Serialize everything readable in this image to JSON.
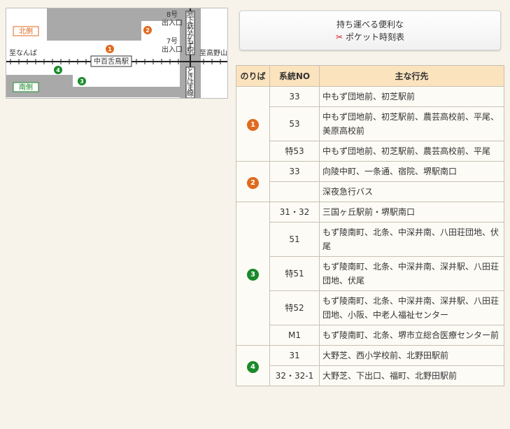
{
  "map": {
    "north_side": "北側",
    "south_side": "南側",
    "exit8": [
      "8号",
      "出入口"
    ],
    "exit7": [
      "7号",
      "出入口"
    ],
    "to_namba": "至なんば",
    "to_koyasan": "至高野山",
    "station": "中百舌鳥駅",
    "subway_station": [
      "地",
      "下",
      "鉄",
      "な",
      "か",
      "も",
      "ず",
      "駅"
    ],
    "tokihama_line": [
      "と",
      "き",
      "は",
      "ま",
      "線"
    ],
    "stop_labels": [
      "1",
      "2",
      "3",
      "4"
    ]
  },
  "pocket": {
    "line1": "持ち運べる便利な",
    "line2": "ポケット時刻表",
    "icon": "pdf-icon"
  },
  "colors": {
    "orange": "#e06a1f",
    "green": "#1a8a2a"
  },
  "table": {
    "headers": [
      "のりば",
      "系統NO",
      "主な行先"
    ],
    "groups": [
      {
        "stop": "1",
        "color": "#e06a1f",
        "rows": [
          {
            "no": "33",
            "dest": "中もず団地前、初芝駅前"
          },
          {
            "no": "53",
            "dest": "中もず団地前、初芝駅前、農芸高校前、平尾、美原高校前"
          },
          {
            "no": "特53",
            "dest": "中もず団地前、初芝駅前、農芸高校前、平尾"
          }
        ]
      },
      {
        "stop": "2",
        "color": "#e06a1f",
        "rows": [
          {
            "no": "33",
            "dest": "向陵中町、一条通、宿院、堺駅南口"
          },
          {
            "no": "",
            "dest": "深夜急行バス"
          }
        ]
      },
      {
        "stop": "3",
        "color": "#1a8a2a",
        "rows": [
          {
            "no": "31・32",
            "dest": "三国ヶ丘駅前・堺駅南口"
          },
          {
            "no": "51",
            "dest": "もず陵南町、北条、中深井南、八田荘団地、伏尾"
          },
          {
            "no": "特51",
            "dest": "もず陵南町、北条、中深井南、深井駅、八田荘団地、伏尾"
          },
          {
            "no": "特52",
            "dest": "もず陵南町、北条、中深井南、深井駅、八田荘団地、小阪、中老人福祉センター"
          },
          {
            "no": "M1",
            "dest": "もず陵南町、北条、堺市立総合医療センター前"
          }
        ]
      },
      {
        "stop": "4",
        "color": "#1a8a2a",
        "rows": [
          {
            "no": "31",
            "dest": "大野芝、西小学校前、北野田駅前"
          },
          {
            "no": "32・32-1",
            "dest": "大野芝、下出口、福町、北野田駅前"
          }
        ]
      }
    ]
  }
}
